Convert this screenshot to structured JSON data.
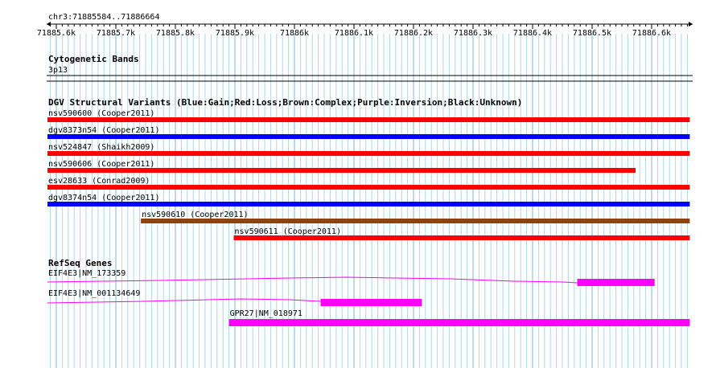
{
  "header": {
    "region_label": "chr3:71885584..71886664"
  },
  "ruler": {
    "ticks": [
      "71885.6k",
      "71885.7k",
      "71885.8k",
      "71885.9k",
      "71886k",
      "71886.1k",
      "71886.2k",
      "71886.3k",
      "71886.4k",
      "71886.5k",
      "71886.6k"
    ]
  },
  "tracks": {
    "cytoband": {
      "title": "Cytogenetic Bands",
      "band": "3p13"
    },
    "dgv": {
      "title": "DGV Structural Variants (Blue:Gain;Red:Loss;Brown:Complex;Purple:Inversion;Black:Unknown)",
      "features": [
        {
          "label": "nsv590600 (Cooper2011)",
          "start": 71885584,
          "end": 71886664,
          "color": "#ff0000"
        },
        {
          "label": "dgv8373n54 (Cooper2011)",
          "start": 71885584,
          "end": 71886664,
          "color": "#0000ff"
        },
        {
          "label": "nsv524847 (Shaikh2009)",
          "start": 71885584,
          "end": 71886664,
          "color": "#ff0000"
        },
        {
          "label": "nsv590606 (Cooper2011)",
          "start": 71885584,
          "end": 71886573,
          "color": "#ff0000"
        },
        {
          "label": "esv28633 (Conrad2009)",
          "start": 71885584,
          "end": 71886664,
          "color": "#ff0000"
        },
        {
          "label": "dgv8374n54 (Cooper2011)",
          "start": 71885584,
          "end": 71886664,
          "color": "#0000ff"
        },
        {
          "label": "nsv590610 (Cooper2011)",
          "start": 71885742,
          "end": 71886664,
          "color": "#8b4513"
        },
        {
          "label": "nsv590611 (Cooper2011)",
          "start": 71885898,
          "end": 71886664,
          "color": "#ff0000"
        }
      ]
    },
    "refseq": {
      "title": "RefSeq Genes",
      "genes": [
        {
          "label": "EIF4E3|NM_173359",
          "exon_start": 71886475,
          "exon_end": 71886605
        },
        {
          "label": "EIF4E3|NM_001134649",
          "exon_start": 71886044,
          "exon_end": 71886214
        },
        {
          "label": "GPR27|NM_018971",
          "exon_start": 71885890,
          "exon_end": 71886664
        }
      ]
    }
  },
  "colors": {
    "gene": "#ff00ff",
    "grid": "#add8e6",
    "grid_major": "#7fb6d0"
  }
}
